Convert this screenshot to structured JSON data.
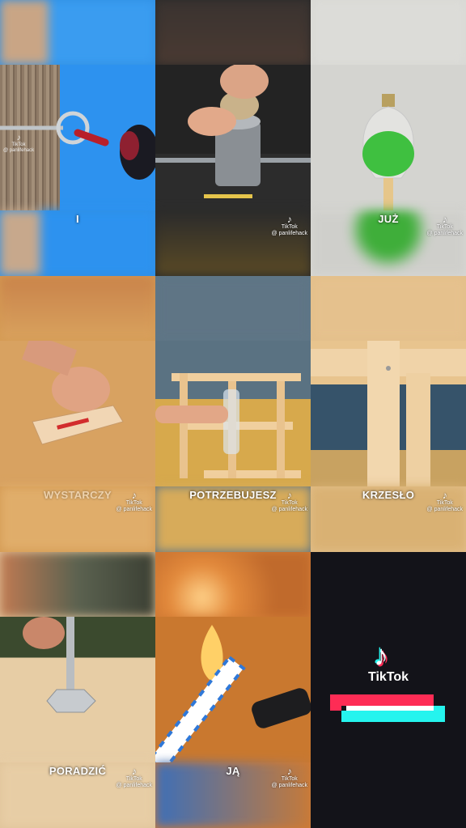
{
  "cells": [
    {
      "caption": "I",
      "watermark_brand": "",
      "watermark_handle": ""
    },
    {
      "caption": "",
      "watermark_brand": "TikTok",
      "watermark_handle": "@ panlifehack"
    },
    {
      "caption": "JUŻ",
      "watermark_brand": "TikTok",
      "watermark_handle": "@ panlifehack"
    },
    {
      "caption": "WYSTARCZY",
      "watermark_brand": "TikTok",
      "watermark_handle": "@ panlifehack"
    },
    {
      "caption": "POTRZEBUJESZ",
      "watermark_brand": "TikTok",
      "watermark_handle": "@ panlifehack"
    },
    {
      "caption": "KRZESŁO",
      "watermark_brand": "TikTok",
      "watermark_handle": "@ panlifehack"
    },
    {
      "caption": "PORADZIĆ",
      "watermark_brand": "TikTok",
      "watermark_handle": "@ panlifehack"
    },
    {
      "caption": "JĄ",
      "watermark_brand": "TikTok",
      "watermark_handle": "@ panlifehack"
    }
  ],
  "first_cell_watermark": {
    "brand": "TikTok",
    "handle": "@ panlifehack"
  },
  "end_card": {
    "brand": "TikTok"
  },
  "colors": {
    "tiktok_red": "#fe2c55",
    "tiktok_cyan": "#25f4ee",
    "end_bg": "#131319"
  }
}
